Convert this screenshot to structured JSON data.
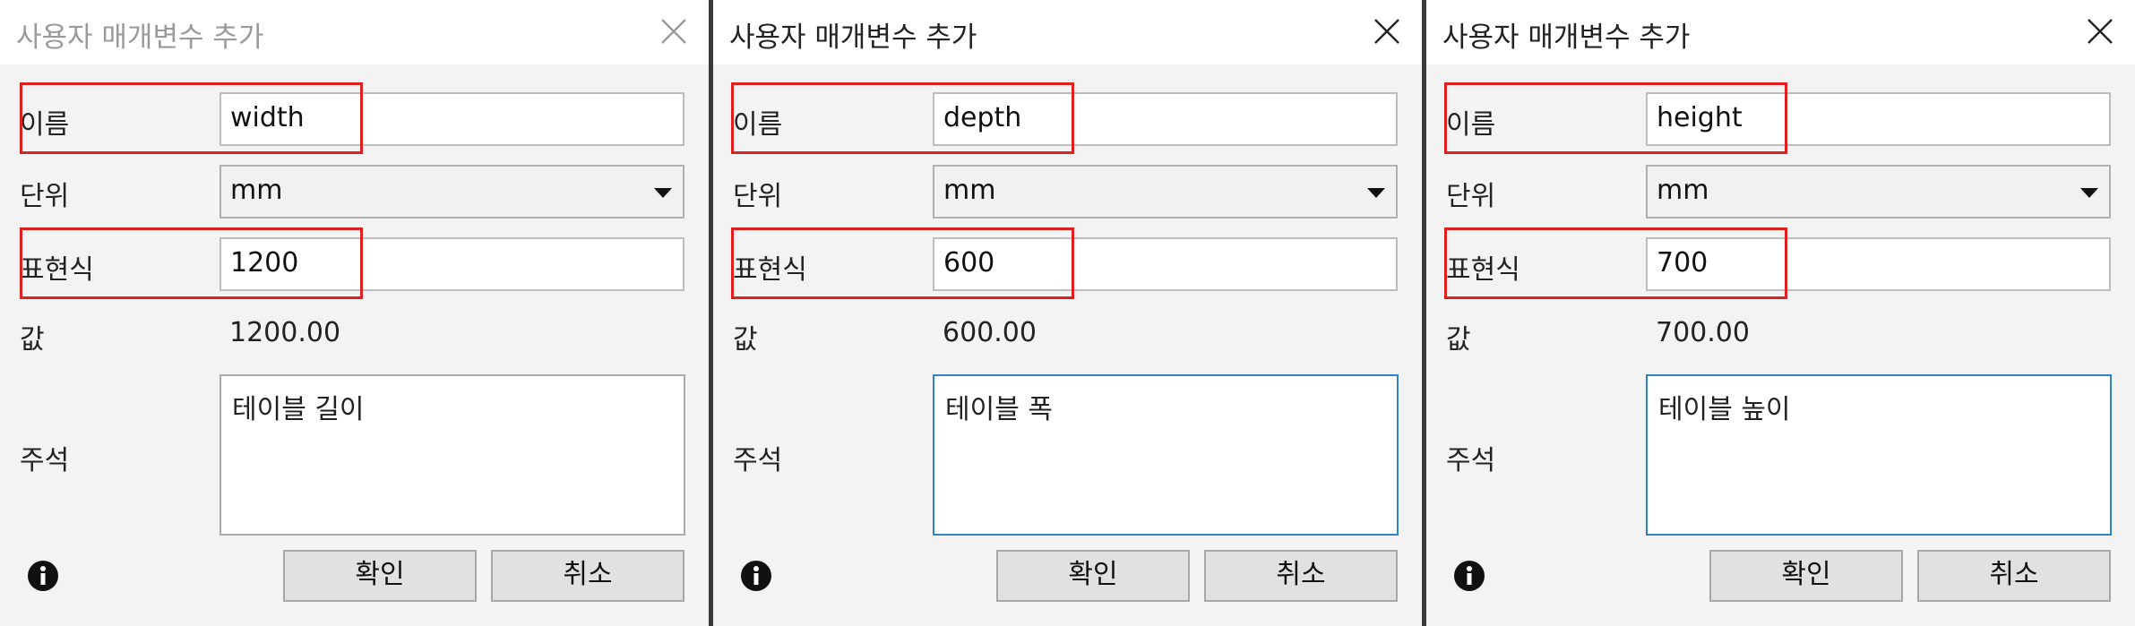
{
  "dialogs": [
    {
      "title": "사용자 매개변수 추가",
      "state": "inactive",
      "name_label": "이름",
      "name_value": "width",
      "unit_label": "단위",
      "unit_value": "mm",
      "expression_label": "표현식",
      "expression_value": "1200",
      "value_label": "값",
      "value_value": "1200.00",
      "note_label": "주석",
      "note_value": "테이블 길이",
      "ok_label": "확인",
      "cancel_label": "취소"
    },
    {
      "title": "사용자 매개변수 추가",
      "state": "active",
      "name_label": "이름",
      "name_value": "depth",
      "unit_label": "단위",
      "unit_value": "mm",
      "expression_label": "표현식",
      "expression_value": "600",
      "value_label": "값",
      "value_value": "600.00",
      "note_label": "주석",
      "note_value": "테이블 폭",
      "ok_label": "확인",
      "cancel_label": "취소"
    },
    {
      "title": "사용자 매개변수 추가",
      "state": "active",
      "name_label": "이름",
      "name_value": "height",
      "unit_label": "단위",
      "unit_value": "mm",
      "expression_label": "표현식",
      "expression_value": "700",
      "value_label": "값",
      "value_value": "700.00",
      "note_label": "주석",
      "note_value": "테이블 높이",
      "ok_label": "확인",
      "cancel_label": "취소"
    }
  ],
  "colors": {
    "highlight": "#e0201e",
    "focus_border": "#2f82d0",
    "dialog_bg": "#f3f3f3"
  },
  "icons": {
    "close": "close-icon",
    "info": "info-icon",
    "dropdown": "chevron-down-icon"
  }
}
